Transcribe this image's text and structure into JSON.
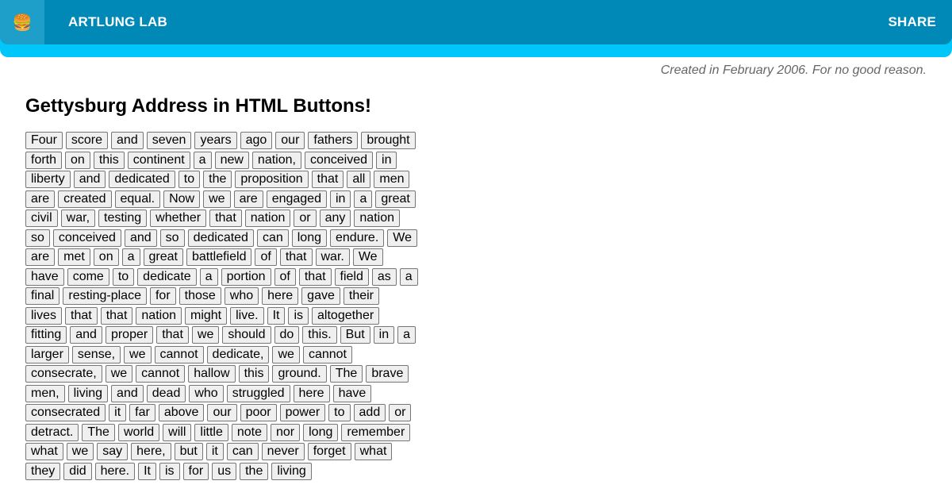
{
  "header": {
    "menu_icon": "🍔",
    "brand": "ARTLUNG LAB",
    "share": "SHARE"
  },
  "tagline": "Created in February 2006. For no good reason.",
  "title": "Gettysburg Address in HTML Buttons!",
  "words": [
    "Four",
    "score",
    "and",
    "seven",
    "years",
    "ago",
    "our",
    "fathers",
    "brought",
    "forth",
    "on",
    "this",
    "continent",
    "a",
    "new",
    "nation,",
    "conceived",
    "in",
    "liberty",
    "and",
    "dedicated",
    "to",
    "the",
    "proposition",
    "that",
    "all",
    "men",
    "are",
    "created",
    "equal.",
    "Now",
    "we",
    "are",
    "engaged",
    "in",
    "a",
    "great",
    "civil",
    "war,",
    "testing",
    "whether",
    "that",
    "nation",
    "or",
    "any",
    "nation",
    "so",
    "conceived",
    "and",
    "so",
    "dedicated",
    "can",
    "long",
    "endure.",
    "We",
    "are",
    "met",
    "on",
    "a",
    "great",
    "battlefield",
    "of",
    "that",
    "war.",
    "We",
    "have",
    "come",
    "to",
    "dedicate",
    "a",
    "portion",
    "of",
    "that",
    "field",
    "as",
    "a",
    "final",
    "resting-place",
    "for",
    "those",
    "who",
    "here",
    "gave",
    "their",
    "lives",
    "that",
    "that",
    "nation",
    "might",
    "live.",
    "It",
    "is",
    "altogether",
    "fitting",
    "and",
    "proper",
    "that",
    "we",
    "should",
    "do",
    "this.",
    "But",
    "in",
    "a",
    "larger",
    "sense,",
    "we",
    "cannot",
    "dedicate,",
    "we",
    "cannot",
    "consecrate,",
    "we",
    "cannot",
    "hallow",
    "this",
    "ground.",
    "The",
    "brave",
    "men,",
    "living",
    "and",
    "dead",
    "who",
    "struggled",
    "here",
    "have",
    "consecrated",
    "it",
    "far",
    "above",
    "our",
    "poor",
    "power",
    "to",
    "add",
    "or",
    "detract.",
    "The",
    "world",
    "will",
    "little",
    "note",
    "nor",
    "long",
    "remember",
    "what",
    "we",
    "say",
    "here,",
    "but",
    "it",
    "can",
    "never",
    "forget",
    "what",
    "they",
    "did",
    "here.",
    "It",
    "is",
    "for",
    "us",
    "the",
    "living"
  ],
  "colors": {
    "header_dark": "#0089b6",
    "header_light": "#00c6f9",
    "button_bg": "#efefef"
  }
}
